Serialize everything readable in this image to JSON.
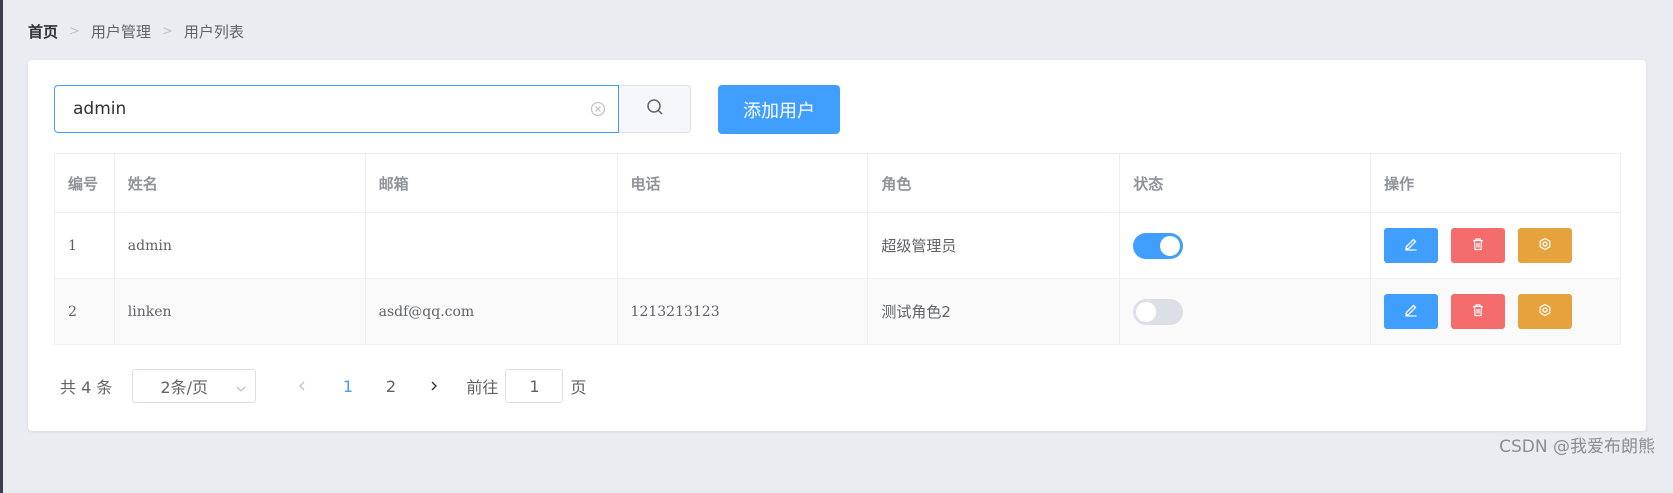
{
  "breadcrumb": {
    "home": "首页",
    "level1": "用户管理",
    "level2": "用户列表"
  },
  "search": {
    "value": "admin",
    "placeholder": ""
  },
  "toolbar": {
    "add_label": "添加用户"
  },
  "table": {
    "headers": [
      "编号",
      "姓名",
      "邮箱",
      "电话",
      "角色",
      "状态",
      "操作"
    ],
    "rows": [
      {
        "index": "1",
        "name": "admin",
        "email": "",
        "phone": "",
        "role": "超级管理员",
        "status_on": true
      },
      {
        "index": "2",
        "name": "linken",
        "email": "asdf@qq.com",
        "phone": "1213213123",
        "role": "测试角色2",
        "status_on": false
      }
    ]
  },
  "pagination": {
    "total_prefix": "共",
    "total": "4",
    "total_suffix": "条",
    "page_size": "2条/页",
    "pages": [
      "1",
      "2"
    ],
    "current_page": "1",
    "goto_prefix": "前往",
    "goto_value": "1",
    "goto_suffix": "页"
  },
  "colors": {
    "primary": "#409eff",
    "danger": "#f56c6c",
    "warning": "#e6a23c",
    "switch_off": "#dcdfe6"
  },
  "icons": {
    "clear": "circle-x-icon",
    "search": "search-icon",
    "edit": "pencil-icon",
    "delete": "trash-icon",
    "settings": "gear-icon",
    "prev": "chevron-left-icon",
    "next": "chevron-right-icon",
    "dropdown": "chevron-down-icon"
  },
  "watermark": "CSDN @我爱布朗熊"
}
